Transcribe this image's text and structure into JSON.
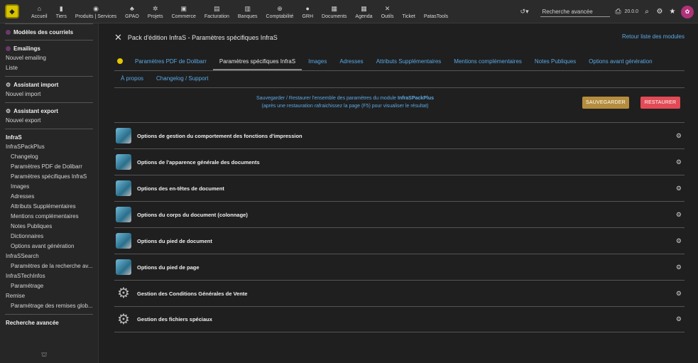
{
  "topbar": {
    "menu": [
      {
        "icon": "⌂",
        "icon_name": "home-icon",
        "label": "Accueil"
      },
      {
        "icon": "▮",
        "icon_name": "building-icon",
        "label": "Tiers"
      },
      {
        "icon": "◉",
        "icon_name": "cube-icon",
        "label": "Produits | Services"
      },
      {
        "icon": "♣",
        "icon_name": "gpao-icon",
        "label": "GPAO"
      },
      {
        "icon": "✲",
        "icon_name": "projects-icon",
        "label": "Projets"
      },
      {
        "icon": "▣",
        "icon_name": "commerce-icon",
        "label": "Commerce"
      },
      {
        "icon": "▤",
        "icon_name": "invoice-icon",
        "label": "Facturation"
      },
      {
        "icon": "▥",
        "icon_name": "bank-icon",
        "label": "Banques"
      },
      {
        "icon": "⊕",
        "icon_name": "accounting-icon",
        "label": "Comptabilité"
      },
      {
        "icon": "●",
        "icon_name": "hr-icon",
        "label": "GRH"
      },
      {
        "icon": "▦",
        "icon_name": "documents-icon",
        "label": "Documents"
      },
      {
        "icon": "▦",
        "icon_name": "calendar-icon",
        "label": "Agenda"
      },
      {
        "icon": "✕",
        "icon_name": "tools-icon",
        "label": "Outils"
      },
      {
        "icon": "",
        "icon_name": "ticket-icon",
        "label": "Ticket"
      },
      {
        "icon": "",
        "icon_name": "patastools-icon",
        "label": "PatasTools"
      }
    ],
    "search_placeholder": "Recherche avancée",
    "version": "20.0.0"
  },
  "sidebar": {
    "blocks": [
      {
        "title": "Modèles des courriels",
        "dot": true,
        "links": []
      },
      {
        "title": "Emailings",
        "dot": true,
        "links": [
          {
            "label": "Nouvel emailing",
            "sub": false
          },
          {
            "label": "Liste",
            "sub": false
          }
        ]
      },
      {
        "title": "Assistant import",
        "gear": true,
        "links": [
          {
            "label": "Nouvel import",
            "sub": false
          }
        ]
      },
      {
        "title": "Assistant export",
        "gear": true,
        "links": [
          {
            "label": "Nouvel export",
            "sub": false
          }
        ]
      },
      {
        "title": "InfraS",
        "links": [
          {
            "label": "InfraSPackPlus",
            "sub": false
          },
          {
            "label": "Changelog",
            "sub": true
          },
          {
            "label": "Paramètres PDF de Dolibarr",
            "sub": true
          },
          {
            "label": "Paramètres spécifiques InfraS",
            "sub": true
          },
          {
            "label": "Images",
            "sub": true
          },
          {
            "label": "Adresses",
            "sub": true
          },
          {
            "label": "Attributs Supplémentaires",
            "sub": true
          },
          {
            "label": "Mentions complémentaires",
            "sub": true
          },
          {
            "label": "Notes Publiques",
            "sub": true
          },
          {
            "label": "Dictionnaires",
            "sub": true
          },
          {
            "label": "Options avant génération",
            "sub": true
          },
          {
            "label": "InfraSSearch",
            "sub": false
          },
          {
            "label": "Paramètres de la recherche av...",
            "sub": true
          },
          {
            "label": "InfraSTechInfos",
            "sub": false
          },
          {
            "label": "Paramétrage",
            "sub": true
          },
          {
            "label": "Remise",
            "sub": false
          },
          {
            "label": "Paramétrage des remises glob...",
            "sub": true
          }
        ]
      },
      {
        "title": "Recherche avancée",
        "links": []
      }
    ]
  },
  "main": {
    "title": "Pack d'édition InfraS - Paramètres spécifiques InfraS",
    "back_link": "Retour liste des modules",
    "tabs_row1": [
      {
        "label": "Paramètres PDF de Dolibarr",
        "active": false
      },
      {
        "label": "Paramètres spécifiques InfraS",
        "active": true
      },
      {
        "label": "Images",
        "active": false
      },
      {
        "label": "Adresses",
        "active": false
      },
      {
        "label": "Attributs Supplémentaires",
        "active": false
      },
      {
        "label": "Mentions complémentaires",
        "active": false
      },
      {
        "label": "Notes Publiques",
        "active": false
      },
      {
        "label": "Options avant génération",
        "active": false
      }
    ],
    "tabs_row2": [
      {
        "label": "À propos"
      },
      {
        "label": "Changelog / Support"
      }
    ],
    "save_text_1": "Sauvegarder / Restaurer l'ensemble des paramètres du module",
    "save_text_module": "InfraSPackPlus",
    "save_text_2": "(après une restauration rafraichissez la page (F5) pour visualiser le résultat)",
    "save_button": "SAUVEGARDER",
    "restore_button": "RESTAURER",
    "sections": [
      {
        "title": "Options de gestion du comportement des fonctions d'impression",
        "icon": "cube"
      },
      {
        "title": "Options de l'apparence générale des documents",
        "icon": "cube"
      },
      {
        "title": "Options des en-têtes de document",
        "icon": "cube"
      },
      {
        "title": "Options du corps du document (colonnage)",
        "icon": "cube"
      },
      {
        "title": "Options du pied de document",
        "icon": "cube"
      },
      {
        "title": "Options du pied de page",
        "icon": "cube"
      },
      {
        "title": "Gestion des Conditions Générales de Vente",
        "icon": "gears"
      },
      {
        "title": "Gestion des fichiers spéciaux",
        "icon": "gears"
      }
    ]
  },
  "colors": {
    "link": "#5aa9e6",
    "save": "#b58d3e",
    "restore": "#e24a55",
    "background": "#1f1f1f"
  }
}
